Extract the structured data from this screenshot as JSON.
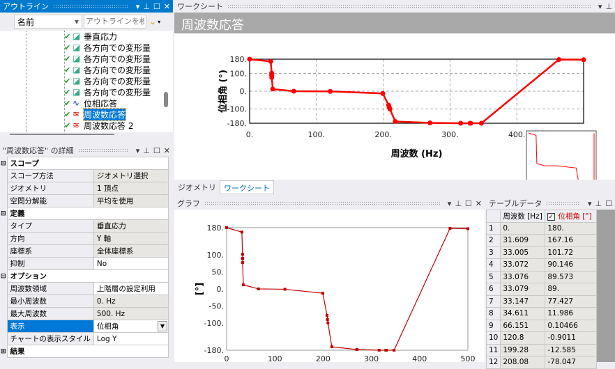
{
  "outline": {
    "title": "アウトライン",
    "name_label": "名前",
    "search_placeholder": "アウトラインを検索",
    "items": [
      {
        "label": "垂直応力",
        "icon": "stress-result-icon"
      },
      {
        "label": "各方向での変形量",
        "icon": "deformation-result-icon"
      },
      {
        "label": "各方向での変形量",
        "icon": "deformation-result-icon"
      },
      {
        "label": "各方向での変形量",
        "icon": "deformation-result-icon"
      },
      {
        "label": "各方向での変形量",
        "icon": "deformation-result-icon"
      },
      {
        "label": "各方向での変形量",
        "icon": "deformation-result-icon"
      },
      {
        "label": "位相応答",
        "icon": "phase-response-icon"
      },
      {
        "label": "周波数応答",
        "icon": "frequency-response-icon",
        "selected": true
      },
      {
        "label": "周波数応答 2",
        "icon": "frequency-response-icon"
      }
    ]
  },
  "details": {
    "title": "\"周波数応答\" の詳細",
    "groups": [
      {
        "label": "スコープ",
        "rows": [
          [
            "スコープ方法",
            "ジオメトリ選択"
          ],
          [
            "ジオメトリ",
            "1 頂点"
          ],
          [
            "空間分解能",
            "平均を使用"
          ]
        ]
      },
      {
        "label": "定義",
        "rows": [
          [
            "タイプ",
            "垂直応力"
          ],
          [
            "方向",
            "Y 軸"
          ],
          [
            "座標系",
            "全体座標系"
          ],
          [
            "抑制",
            "No"
          ]
        ]
      },
      {
        "label": "オプション",
        "rows": [
          [
            "周波数領域",
            "上階層の設定利用"
          ],
          [
            "最小周波数",
            "0. Hz"
          ],
          [
            "最大周波数",
            "500. Hz"
          ],
          [
            "表示",
            "位相角"
          ],
          [
            "チャートの表示スタイル",
            "Log Y"
          ]
        ]
      },
      {
        "label": "結果",
        "rows": []
      }
    ]
  },
  "worksheet": {
    "title": "ワークシート",
    "heading": "周波数応答"
  },
  "tabs": [
    {
      "label": "ジオメトリ"
    },
    {
      "label": "ワークシート"
    }
  ],
  "graph": {
    "title": "グラフ"
  },
  "table": {
    "title": "テーブルデータ",
    "col1": "周波数 [Hz]",
    "col2": "位相角 [°]",
    "rows": [
      [
        "1",
        "0.",
        "180."
      ],
      [
        "2",
        "31.609",
        "167.16"
      ],
      [
        "3",
        "33.005",
        "101.72"
      ],
      [
        "4",
        "33.072",
        "90.146"
      ],
      [
        "5",
        "33.076",
        "89.573"
      ],
      [
        "6",
        "33.079",
        "89."
      ],
      [
        "7",
        "33.147",
        "77.427"
      ],
      [
        "8",
        "34.611",
        "11.986"
      ],
      [
        "9",
        "66.151",
        "0.10466"
      ],
      [
        "10",
        "120.8",
        "-0.9011"
      ],
      [
        "11",
        "199.28",
        "-12.585"
      ],
      [
        "12",
        "208.08",
        "-78.047"
      ]
    ]
  },
  "colors": {
    "accent": "#007acc",
    "series_top": "#ff0000",
    "series_bottom": "#c00000"
  },
  "chart_data": [
    {
      "type": "line",
      "title": "周波数応答",
      "xlabel": "周波数 (Hz)",
      "ylabel": "位相角 (°)",
      "xlim": [
        0,
        500
      ],
      "ylim": [
        -180,
        180
      ],
      "xticks": [
        "0.",
        "100.",
        "200.",
        "300.",
        "400."
      ],
      "xtickvals": [
        0,
        100,
        200,
        300,
        400
      ],
      "yticks": [
        "180.",
        "100.",
        "0.",
        "-100.",
        "-180."
      ],
      "ytickvals": [
        180,
        100,
        0,
        -100,
        -180
      ],
      "grid": true,
      "x": [
        0,
        31.609,
        33.005,
        33.072,
        33.076,
        33.079,
        33.147,
        34.611,
        66.151,
        120.8,
        199.28,
        208.08,
        209,
        210,
        218,
        270,
        316,
        330,
        331,
        347,
        463,
        500
      ],
      "y": [
        180,
        167.16,
        101.72,
        90.146,
        89.573,
        89,
        77.427,
        11.986,
        0.10466,
        -0.9011,
        -12.585,
        -78.047,
        -90,
        -100,
        -170,
        -178,
        -180,
        -180,
        -180,
        -180,
        178,
        177
      ]
    },
    {
      "type": "line",
      "xlabel": "",
      "ylabel": "[°]",
      "xlim": [
        0,
        500
      ],
      "ylim": [
        -180,
        180
      ],
      "xticks": [
        "0",
        "100",
        "200",
        "300",
        "400",
        "500"
      ],
      "xtickvals": [
        0,
        100,
        200,
        300,
        400,
        500
      ],
      "yticks": [
        "180.",
        "100.",
        "50.",
        "0.",
        "-50.",
        "-100.",
        "-180."
      ],
      "ytickvals": [
        180,
        100,
        50,
        0,
        -50,
        -100,
        -180
      ],
      "grid": false
    }
  ]
}
